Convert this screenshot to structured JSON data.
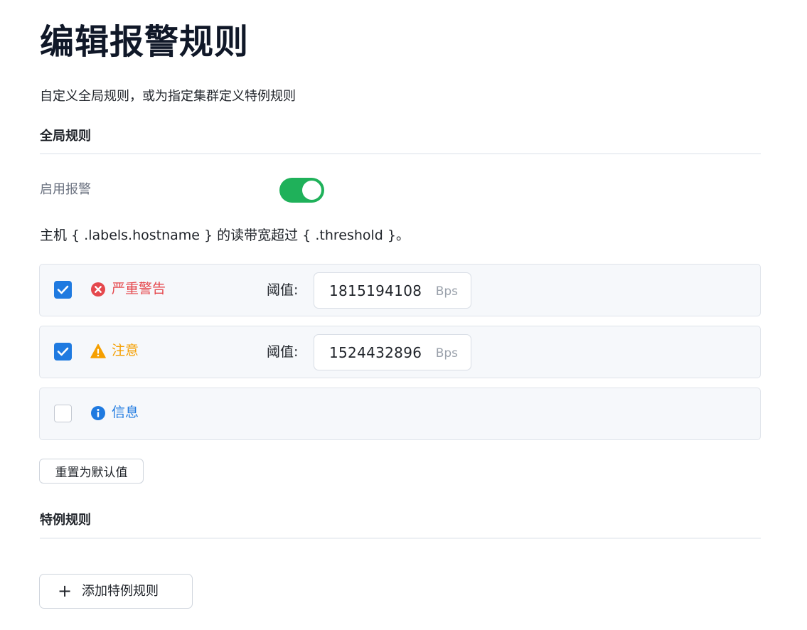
{
  "page": {
    "title": "编辑报警规则",
    "description": "自定义全局规则，或为指定集群定义特例规则"
  },
  "global_rules": {
    "title": "全局规则",
    "enable_label": "启用报警",
    "enabled": true,
    "template": "主机 { .labels.hostname } 的读带宽超过 { .threshold }。",
    "rules": [
      {
        "level": "严重警告",
        "icon": "x-circle-icon",
        "color": "#e5484d",
        "checked": true,
        "threshold_label": "阈值:",
        "threshold_value": "1815194108",
        "unit": "Bps"
      },
      {
        "level": "注意",
        "icon": "warning-triangle-icon",
        "color": "#f59f00",
        "checked": true,
        "threshold_label": "阈值:",
        "threshold_value": "1524432896",
        "unit": "Bps"
      },
      {
        "level": "信息",
        "icon": "info-circle-icon",
        "color": "#1f7ae0",
        "checked": false
      }
    ],
    "reset_label": "重置为默认值"
  },
  "exception_rules": {
    "title": "特例规则",
    "add_label": "添加特例规则"
  },
  "colors": {
    "accent": "#1f7ae0",
    "toggle_on": "#1fb15a",
    "critical": "#e5484d",
    "warning": "#f59f00",
    "info": "#1f7ae0"
  }
}
